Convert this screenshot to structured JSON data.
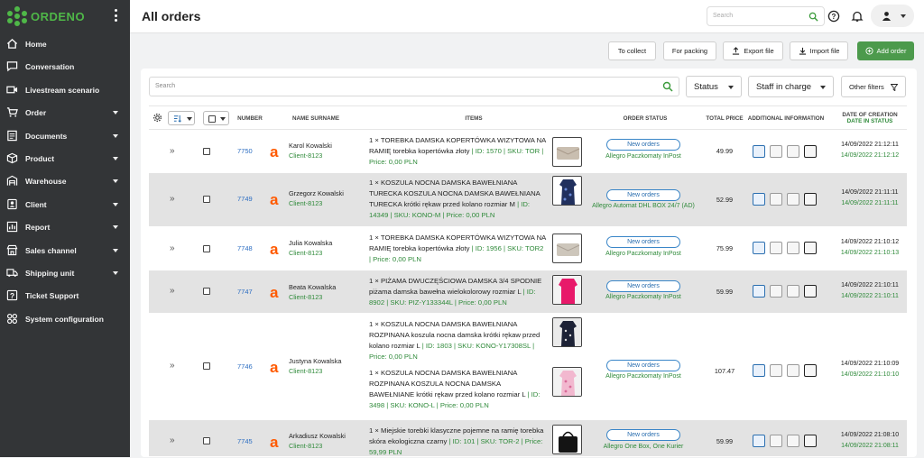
{
  "brand": {
    "name": "ORDENO",
    "color": "#4fb848"
  },
  "nav": [
    {
      "label": "Home",
      "icon": "home-icon",
      "caret": false
    },
    {
      "label": "Conversation",
      "icon": "chat-icon",
      "caret": false
    },
    {
      "label": "Livestream scenario",
      "icon": "video-icon",
      "caret": false
    },
    {
      "label": "Order",
      "icon": "cart-icon",
      "caret": true
    },
    {
      "label": "Documents",
      "icon": "document-icon",
      "caret": true
    },
    {
      "label": "Product",
      "icon": "box-icon",
      "caret": true
    },
    {
      "label": "Warehouse",
      "icon": "warehouse-icon",
      "caret": true
    },
    {
      "label": "Client",
      "icon": "user-icon",
      "caret": true
    },
    {
      "label": "Report",
      "icon": "report-icon",
      "caret": true
    },
    {
      "label": "Sales channel",
      "icon": "sales-icon",
      "caret": true
    },
    {
      "label": "Shipping unit",
      "icon": "truck-icon",
      "caret": true
    },
    {
      "label": "Ticket Support",
      "icon": "question-icon",
      "caret": false
    },
    {
      "label": "System configuration",
      "icon": "config-icon",
      "caret": false
    }
  ],
  "header": {
    "title": "All orders",
    "search_placeholder": "Search"
  },
  "actions": {
    "collect": "To collect",
    "packing": "For packing",
    "export": "Export file",
    "import": "Import file",
    "add": "Add order"
  },
  "filters": {
    "search_placeholder": "Search",
    "status": "Status",
    "staff": "Staff in charge",
    "other": "Other filters"
  },
  "columns": {
    "number": "NUMBER",
    "name": "NAME SURNAME",
    "items": "ITEMS",
    "status": "ORDER STATUS",
    "price": "TOTAL PRICE",
    "info": "ADDITIONAL INFORMATION",
    "date1": "DATE OF CREATION",
    "date2": "DATE IN STATUS"
  },
  "orders": [
    {
      "number": "7750",
      "name": "Karol Kowalski",
      "client": "Client-8123",
      "items": [
        {
          "text": "1 × TOREBKA DAMSKA KOPERTÓWKA WIZYTOWA NA RAMIĘ torebka kopertówka złoty",
          "detail": "| ID: 1570 | SKU: TOR | Price: 0,00 PLN"
        }
      ],
      "status": "New orders",
      "carrier": "Allegro Paczkomaty InPost",
      "price": "49.99",
      "created": "14/09/2022 21:12:11",
      "in_status": "14/09/2022 21:12:12"
    },
    {
      "number": "7749",
      "name": "Grzegorz Kowalski",
      "client": "Client-8123",
      "items": [
        {
          "text": "1 × KOSZULA NOCNA DAMSKA BAWEŁNIANA TURECKA KOSZULA NOCNA DAMSKA BAWEŁNIANA TURECKA krótki rękaw przed kolano rozmiar M",
          "detail": "| ID: 14349 | SKU: KONO-M | Price: 0,00 PLN"
        }
      ],
      "status": "New orders",
      "carrier": "Allegro Automat DHL BOX 24/7 (AD)",
      "price": "52.99",
      "created": "14/09/2022 21:11:11",
      "in_status": "14/09/2022 21:11:11"
    },
    {
      "number": "7748",
      "name": "Julia Kowalska",
      "client": "Client-8123",
      "items": [
        {
          "text": "1 × TOREBKA DAMSKA KOPERTÓWKA WIZYTOWA NA RAMIĘ torebka kopertówka złoty",
          "detail": "| ID: 1956 | SKU: TOR2 | Price: 0,00 PLN"
        }
      ],
      "status": "New orders",
      "carrier": "Allegro Paczkomaty InPost",
      "price": "75.99",
      "created": "14/09/2022 21:10:12",
      "in_status": "14/09/2022 21:10:13"
    },
    {
      "number": "7747",
      "name": "Beata Kowalska",
      "client": "Client-8123",
      "items": [
        {
          "text": "1 × PIŻAMA DWUCZĘŚCIOWA DAMSKA 3/4 SPODNIE piżama damska bawełna wielokolorowy rozmiar L",
          "detail": "| ID: 8902 | SKU: PIZ-Y133344L | Price: 0,00 PLN"
        }
      ],
      "status": "New orders",
      "carrier": "Allegro Paczkomaty InPost",
      "price": "59.99",
      "created": "14/09/2022 21:10:11",
      "in_status": "14/09/2022 21:10:11"
    },
    {
      "number": "7746",
      "name": "Justyna Kowalska",
      "client": "Client-8123",
      "items": [
        {
          "text": "1 × KOSZULA NOCNA DAMSKA BAWEŁNIANA ROZPINANA koszula nocna damska krótki rękaw przed kolano rozmiar L",
          "detail": "| ID: 1803 | SKU: KONO-Y17308SL | Price: 0,00 PLN"
        },
        {
          "text": "1 × KOSZULA NOCNA DAMSKA BAWEŁNIANA ROZPINANA KOSZULA NOCNA DAMSKA BAWEŁNIANE krótki rękaw przed kolano rozmiar L",
          "detail": "| ID: 3498 | SKU: KONO-L | Price: 0,00 PLN"
        }
      ],
      "status": "New orders",
      "carrier": "Allegro Paczkomaty InPost",
      "price": "107.47",
      "created": "14/09/2022 21:10:09",
      "in_status": "14/09/2022 21:10:10"
    },
    {
      "number": "7745",
      "name": "Arkadiusz Kowalski",
      "client": "Client-8123",
      "items": [
        {
          "text": "1 × Miejskie torebki klasyczne pojemne na ramię torebka skóra ekologiczna czarny",
          "detail": "| ID: 101 | SKU: TOR-2 | Price: 59,99 PLN"
        }
      ],
      "status": "New orders",
      "carrier": "Allegro One Box, One Kurier",
      "price": "59.99",
      "created": "14/09/2022 21:08:10",
      "in_status": "14/09/2022 21:08:11"
    }
  ]
}
